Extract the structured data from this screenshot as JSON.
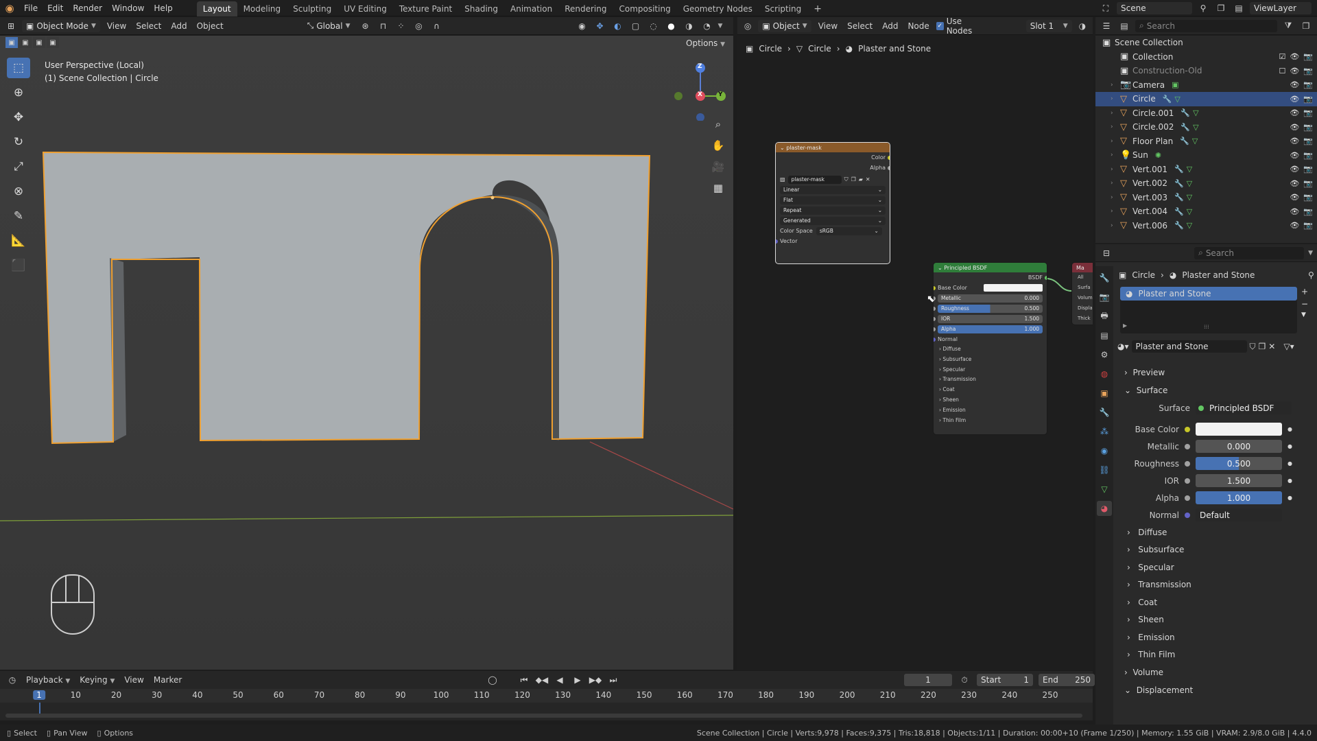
{
  "menu": [
    "File",
    "Edit",
    "Render",
    "Window",
    "Help"
  ],
  "workspaces": [
    "Layout",
    "Modeling",
    "Sculpting",
    "UV Editing",
    "Texture Paint",
    "Shading",
    "Animation",
    "Rendering",
    "Compositing",
    "Geometry Nodes",
    "Scripting"
  ],
  "active_workspace": "Layout",
  "scene": {
    "label": "Scene",
    "viewlayer": "ViewLayer"
  },
  "viewport_header": {
    "mode": "Object Mode",
    "menus": [
      "View",
      "Select",
      "Add",
      "Object"
    ],
    "transform": "Global",
    "options": "Options"
  },
  "viewport_overlay": {
    "line1": "User Perspective (Local)",
    "line2": "(1) Scene Collection | Circle"
  },
  "gizmo": {
    "z": "Z",
    "x": "X",
    "y": "Y"
  },
  "node_header": {
    "type": "Object",
    "menus": [
      "View",
      "Select",
      "Add",
      "Node"
    ],
    "use_nodes": "Use Nodes",
    "slot": "Slot 1"
  },
  "breadcrumb": [
    "Circle",
    "Circle",
    "Plaster and Stone"
  ],
  "image_node": {
    "title": "plaster-mask",
    "outputs": [
      "Color",
      "Alpha"
    ],
    "image": "plaster-mask",
    "options": [
      "Linear",
      "Flat",
      "Repeat",
      "Generated"
    ],
    "color_space_label": "Color Space",
    "color_space": "sRGB",
    "input": "Vector"
  },
  "bsdf_node": {
    "title": "Principled BSDF",
    "output": "BSDF",
    "base_color": "Base Color",
    "fields": [
      {
        "label": "Metallic",
        "value": "0.000",
        "fill": 0.0
      },
      {
        "label": "Roughness",
        "value": "0.500",
        "fill": 0.5
      },
      {
        "label": "IOR",
        "value": "1.500",
        "fill": 0.0
      },
      {
        "label": "Alpha",
        "value": "1.000",
        "fill": 1.0
      }
    ],
    "normal": "Normal",
    "sections": [
      "Diffuse",
      "Subsurface",
      "Specular",
      "Transmission",
      "Coat",
      "Sheen",
      "Emission",
      "Thin Film"
    ]
  },
  "output_node": {
    "title": "Ma",
    "rows": [
      "All",
      "Surfa",
      "Volum",
      "Displa",
      "Thick"
    ]
  },
  "outliner": {
    "search_placeholder": "Search",
    "root": "Scene Collection",
    "items": [
      {
        "name": "Collection",
        "level": 1,
        "type": "collection",
        "selected": false,
        "dim": false
      },
      {
        "name": "Construction-Old",
        "level": 1,
        "type": "collection",
        "selected": false,
        "dim": true
      },
      {
        "name": "Camera",
        "level": 1,
        "type": "camera",
        "selected": false,
        "dim": false
      },
      {
        "name": "Circle",
        "level": 1,
        "type": "mesh",
        "selected": true,
        "dim": false
      },
      {
        "name": "Circle.001",
        "level": 1,
        "type": "mesh",
        "selected": false,
        "dim": false
      },
      {
        "name": "Circle.002",
        "level": 1,
        "type": "mesh",
        "selected": false,
        "dim": false
      },
      {
        "name": "Floor Plan",
        "level": 1,
        "type": "mesh",
        "selected": false,
        "dim": false
      },
      {
        "name": "Sun",
        "level": 1,
        "type": "light",
        "selected": false,
        "dim": false
      },
      {
        "name": "Vert.001",
        "level": 1,
        "type": "mesh",
        "selected": false,
        "dim": false
      },
      {
        "name": "Vert.002",
        "level": 1,
        "type": "mesh",
        "selected": false,
        "dim": false
      },
      {
        "name": "Vert.003",
        "level": 1,
        "type": "mesh",
        "selected": false,
        "dim": false
      },
      {
        "name": "Vert.004",
        "level": 1,
        "type": "mesh",
        "selected": false,
        "dim": false
      },
      {
        "name": "Vert.006",
        "level": 1,
        "type": "mesh",
        "selected": false,
        "dim": false
      }
    ]
  },
  "properties": {
    "search_placeholder": "Search",
    "breadcrumb": [
      "Circle",
      "Plaster and Stone"
    ],
    "slot_material": "Plaster and Stone",
    "material_name": "Plaster and Stone",
    "preview": "Preview",
    "surface_section": "Surface",
    "surface_label": "Surface",
    "surface_value": "Principled BSDF",
    "fields": [
      {
        "label": "Base Color",
        "value": "",
        "kind": "color",
        "fill": 0
      },
      {
        "label": "Metallic",
        "value": "0.000",
        "kind": "num",
        "fill": 0
      },
      {
        "label": "Roughness",
        "value": "0.500",
        "kind": "num",
        "fill": 0.5
      },
      {
        "label": "IOR",
        "value": "1.500",
        "kind": "num",
        "fill": 0
      },
      {
        "label": "Alpha",
        "value": "1.000",
        "kind": "num",
        "fill": 1
      },
      {
        "label": "Normal",
        "value": "Default",
        "kind": "text",
        "fill": 0
      }
    ],
    "subsections": [
      "Diffuse",
      "Subsurface",
      "Specular",
      "Transmission",
      "Coat",
      "Sheen",
      "Emission",
      "Thin Film"
    ],
    "volume": "Volume",
    "displacement": "Displacement"
  },
  "timeline": {
    "menus": [
      "Playback",
      "Keying",
      "View",
      "Marker"
    ],
    "current": "1",
    "start_label": "Start",
    "start": "1",
    "end_label": "End",
    "end": "250",
    "ticks": [
      "1",
      "10",
      "20",
      "30",
      "40",
      "50",
      "60",
      "70",
      "80",
      "90",
      "100",
      "110",
      "120",
      "130",
      "140",
      "150",
      "160",
      "170",
      "180",
      "190",
      "200",
      "210",
      "220",
      "230",
      "240",
      "250"
    ]
  },
  "status": {
    "left": [
      "Select",
      "Pan View",
      "Options"
    ],
    "right": "Scene Collection | Circle | Verts:9,978 | Faces:9,375 | Tris:18,818 | Objects:1/11 | Duration: 00:00+10 (Frame 1/250) | Memory: 1.55 GiB | VRAM: 2.9/8.0 GiB | 4.4.0"
  },
  "colors": {
    "accent": "#4772b3",
    "selection_outline": "#f0a030",
    "wall": "#a9aeb1",
    "bsdf_header": "#2f7d3a",
    "image_header": "#8a5a2a"
  }
}
